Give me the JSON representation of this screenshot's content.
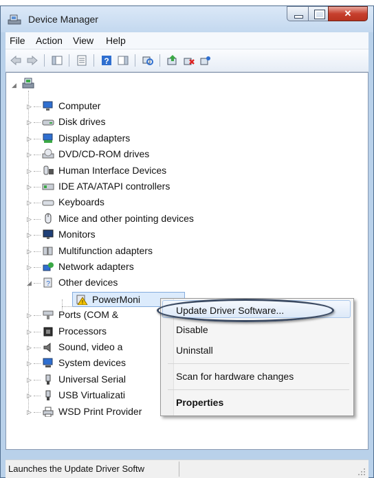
{
  "window": {
    "title": "Device Manager"
  },
  "menubar": {
    "items": [
      "File",
      "Action",
      "View",
      "Help"
    ]
  },
  "toolbar": {
    "icons": [
      "back-arrow-icon",
      "forward-arrow-icon",
      "show-hide-console-tree-icon",
      "properties-icon",
      "help-icon",
      "action-pane-icon",
      "scan-hardware-icon",
      "update-driver-icon",
      "disable-device-icon",
      "uninstall-device-icon"
    ]
  },
  "tree": {
    "root_icon": "computer-root-icon",
    "categories": [
      {
        "label": "Computer",
        "icon": "computer-icon"
      },
      {
        "label": "Disk drives",
        "icon": "disk-drive-icon"
      },
      {
        "label": "Display adapters",
        "icon": "display-adapter-icon"
      },
      {
        "label": "DVD/CD-ROM drives",
        "icon": "dvd-drive-icon"
      },
      {
        "label": "Human Interface Devices",
        "icon": "hid-icon"
      },
      {
        "label": "IDE ATA/ATAPI controllers",
        "icon": "ide-controller-icon"
      },
      {
        "label": "Keyboards",
        "icon": "keyboard-icon"
      },
      {
        "label": "Mice and other pointing devices",
        "icon": "mouse-icon"
      },
      {
        "label": "Monitors",
        "icon": "monitor-icon"
      },
      {
        "label": "Multifunction adapters",
        "icon": "multifunction-icon"
      },
      {
        "label": "Network adapters",
        "icon": "network-adapter-icon"
      },
      {
        "label": "Other devices",
        "icon": "unknown-device-icon"
      },
      {
        "label": "PowerMoni",
        "icon": "warning-device-icon"
      },
      {
        "label": "Ports (COM &",
        "icon": "port-icon"
      },
      {
        "label": "Processors",
        "icon": "processor-icon"
      },
      {
        "label": "Sound, video a",
        "icon": "speaker-icon"
      },
      {
        "label": "System devices",
        "icon": "system-device-icon"
      },
      {
        "label": "Universal Serial",
        "icon": "usb-icon"
      },
      {
        "label": "USB Virtualizati",
        "icon": "usb-virtual-icon"
      },
      {
        "label": "WSD Print Provider",
        "icon": "printer-icon"
      }
    ]
  },
  "context_menu": {
    "items": [
      {
        "label": "Update Driver Software..."
      },
      {
        "label": "Disable"
      },
      {
        "label": "Uninstall"
      },
      {
        "label": "Scan for hardware changes"
      },
      {
        "label": "Properties"
      }
    ]
  },
  "statusbar": {
    "text": "Launches the Update Driver Softw"
  }
}
